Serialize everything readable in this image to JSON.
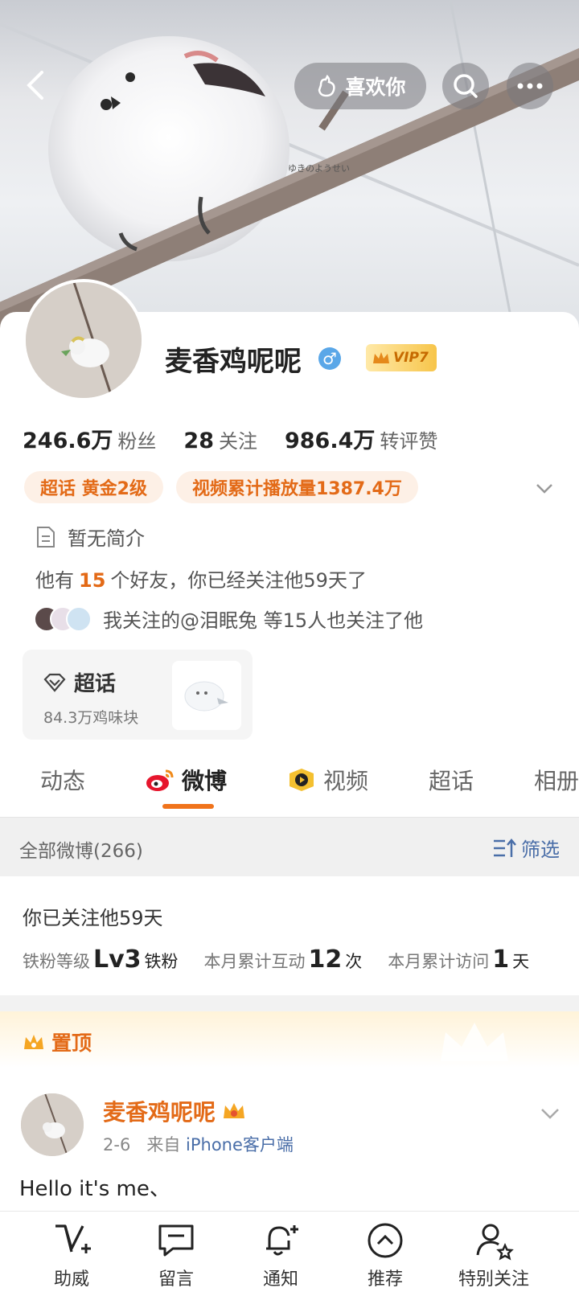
{
  "header": {
    "like_label": "喜欢你",
    "banner_watermark": "ゆきのようせい",
    "icons": [
      "back-icon",
      "like-icon",
      "search-icon",
      "more-icon"
    ]
  },
  "profile": {
    "name": "麦香鸡呢呢",
    "gender": "♂",
    "vip_label": "VIP7",
    "stats": [
      {
        "value": "246.6万",
        "label": "粉丝"
      },
      {
        "value": "28",
        "label": "关注"
      },
      {
        "value": "986.4万",
        "label": "转评赞"
      }
    ],
    "tags": [
      "超话 黄金2级",
      "视频累计播放量1387.4万"
    ],
    "intro": "暂无简介",
    "friends_prefix": "他有",
    "friends_count": "15",
    "friends_suffix": "个好友，你已经关注他59天了",
    "mutual": "我关注的@泪眠兔 等15人也关注了他"
  },
  "super_topic": {
    "title": "超话",
    "subtitle": "84.3万鸡味块"
  },
  "tabs": [
    {
      "label": "动态"
    },
    {
      "label": "微博"
    },
    {
      "label": "视频"
    },
    {
      "label": "超话"
    },
    {
      "label": "相册"
    }
  ],
  "filter_bar": {
    "all_count": "全部微博(266)",
    "filter_label": "筛选"
  },
  "fan_info": {
    "title": "你已关注他59天",
    "level_label": "铁粉等级",
    "level_value": "Lv3",
    "level_name": "铁粉",
    "interact_label": "本月累计互动",
    "interact_value": "12",
    "interact_unit": "次",
    "visit_label": "本月累计访问",
    "visit_value": "1",
    "visit_unit": "天"
  },
  "pinned": {
    "label": "置顶"
  },
  "post": {
    "author": "麦香鸡呢呢",
    "date": "2-6",
    "from": "来自",
    "source": "iPhone客户端",
    "text": "Hello it's me、"
  },
  "bottom_bar": [
    {
      "label": "助威",
      "icon": "cheer-icon"
    },
    {
      "label": "留言",
      "icon": "message-icon"
    },
    {
      "label": "通知",
      "icon": "bell-icon"
    },
    {
      "label": "推荐",
      "icon": "recommend-icon"
    },
    {
      "label": "特别关注",
      "icon": "special-follow-icon"
    }
  ],
  "colors": {
    "accent": "#e36a17",
    "link": "#4a6ea8",
    "tab_underline": "#f0731b"
  }
}
